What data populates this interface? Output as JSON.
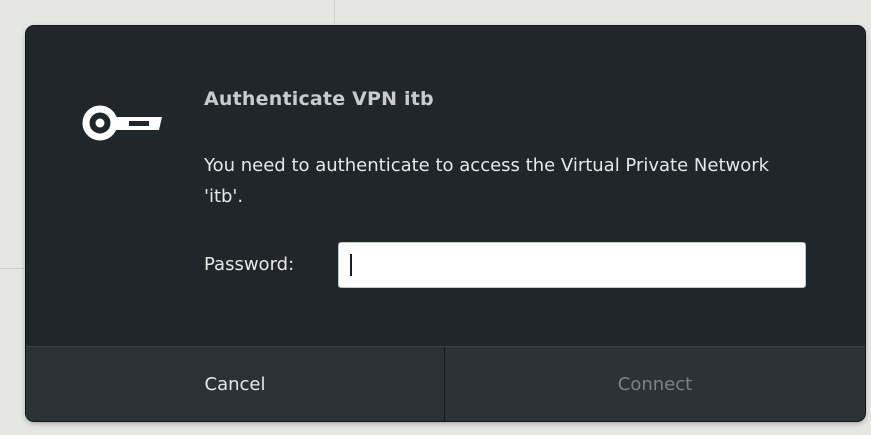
{
  "dialog": {
    "icon": "key-icon",
    "title": "Authenticate VPN itb",
    "message": "You need to authenticate to access the Virtual Private Network 'itb'.",
    "password_label": "Password:",
    "password_value": "",
    "cancel_label": "Cancel",
    "connect_label": "Connect"
  },
  "colors": {
    "dialog_background": "#21262a",
    "button_background": "#2b3135",
    "title_text": "#c9ccca",
    "body_text": "#e7e8e6",
    "disabled_text": "#7d8286"
  }
}
